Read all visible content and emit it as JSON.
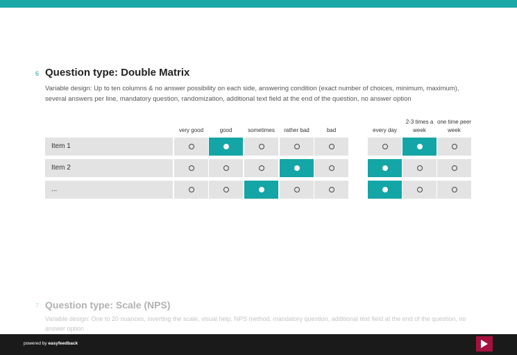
{
  "question6": {
    "number": "6",
    "title": "Question type: Double Matrix",
    "description": "Variable design: Up to ten columns & no answer possibility on each side, answering condition (exact number of choices, minimum, maximum), several answers per line, mandatory question, randomization, additional text field at the end of the question, no answer option",
    "left_columns": [
      "very good",
      "good",
      "sometimes",
      "rather bad",
      "bad"
    ],
    "right_columns": [
      "every day",
      "2-3 times a week",
      "one time peer week"
    ],
    "rows": [
      {
        "label": "Item 1",
        "left_selected": 1,
        "right_selected": 1
      },
      {
        "label": "Item 2",
        "left_selected": 3,
        "right_selected": 0
      },
      {
        "label": "...",
        "left_selected": 2,
        "right_selected": 0
      }
    ]
  },
  "question7": {
    "number": "7",
    "title": "Question type: Scale (NPS)",
    "description": "Variable design: One to 20 nuances, inverting the scale, visual help, NPS method, mandatory question, additional text field at the end of the question, no answer option"
  },
  "footer": {
    "powered_by": "powered by",
    "brand": "easyfeedback"
  },
  "icons": {
    "next": "play-arrow-icon"
  },
  "colors": {
    "accent": "#14a5a6",
    "next_button": "#a4113f",
    "footer_bg": "#1a1a1a"
  }
}
